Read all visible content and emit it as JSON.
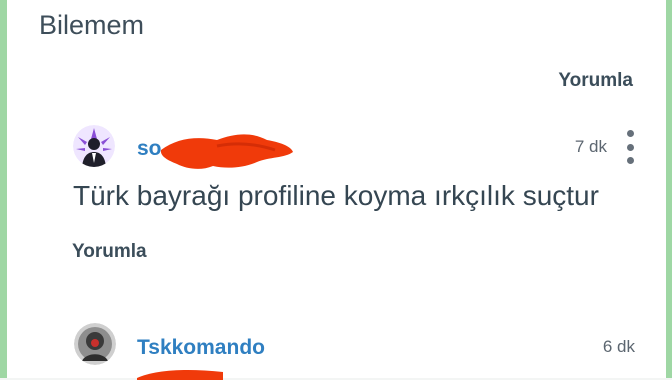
{
  "header": {
    "title": "Bilemem"
  },
  "post": {
    "reply_label": "Yorumla"
  },
  "comments": [
    {
      "username": "so",
      "time": "7 dk",
      "text": "Türk bayrağı profiline koyma ırkçılık suçtur",
      "reply_label": "Yorumla",
      "avatar_icon": "person-silhouette-icon"
    },
    {
      "username": "Tskkomando",
      "time": "6 dk",
      "avatar_icon": "profile-photo-icon"
    }
  ],
  "icons": {
    "more": "more-vertical-icon"
  },
  "colors": {
    "username": "#2f7fc1",
    "text": "#354652",
    "frame": "#9fd7a4",
    "redaction": "#f03a0a"
  }
}
